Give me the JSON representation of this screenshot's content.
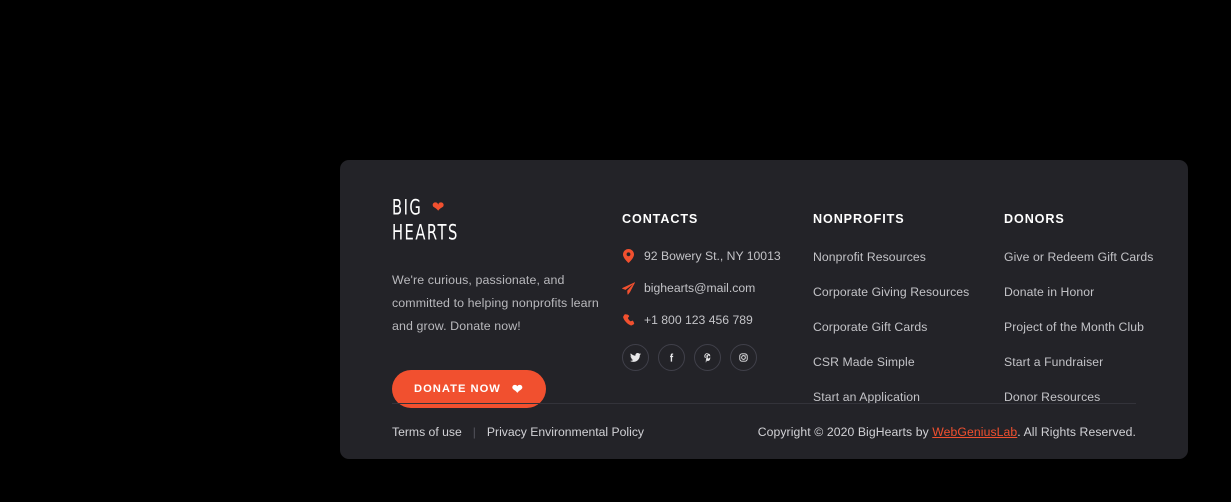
{
  "colors": {
    "page_background": "#000000",
    "footer_background": "#232328",
    "accent": "#f1502f",
    "body_text": "#c3c3c7",
    "heading_text": "#ffffff",
    "divider": "#33333a"
  },
  "brand": {
    "logo_line1": "BIG",
    "logo_line2": "HEARTS",
    "logo_heart_icon": "heart-icon",
    "description": "We're curious, passionate, and committed to helping nonprofits learn and grow. Donate now!",
    "donate_label": "DONATE NOW",
    "donate_heart_icon": "heart-icon"
  },
  "contacts": {
    "title": "CONTACTS",
    "items": [
      {
        "icon": "map-pin-icon",
        "text": "92 Bowery St., NY 10013"
      },
      {
        "icon": "paper-plane-icon",
        "text": "bighearts@mail.com"
      },
      {
        "icon": "phone-icon",
        "text": "+1 800 123 456 789"
      }
    ],
    "social": [
      {
        "icon": "twitter-icon",
        "label": "Twitter"
      },
      {
        "icon": "facebook-icon",
        "label": "Facebook"
      },
      {
        "icon": "pinterest-icon",
        "label": "Pinterest"
      },
      {
        "icon": "instagram-icon",
        "label": "Instagram"
      }
    ]
  },
  "nonprofits": {
    "title": "NONPROFITS",
    "links": [
      "Nonprofit Resources",
      "Corporate Giving Resources",
      "Corporate Gift Cards",
      "CSR Made Simple",
      "Start an Application"
    ]
  },
  "donors": {
    "title": "DONORS",
    "links": [
      "Give or Redeem Gift Cards",
      "Donate in Honor",
      "Project of the Month Club",
      "Start a Fundraiser",
      "Donor Resources"
    ]
  },
  "bottom": {
    "terms_label": "Terms of use",
    "separator": "|",
    "privacy_label": "Privacy Environmental Policy",
    "copyright_prefix": "Copyright © 2020 BigHearts by ",
    "copyright_link": "WebGeniusLab",
    "copyright_suffix": ". All Rights Reserved."
  }
}
